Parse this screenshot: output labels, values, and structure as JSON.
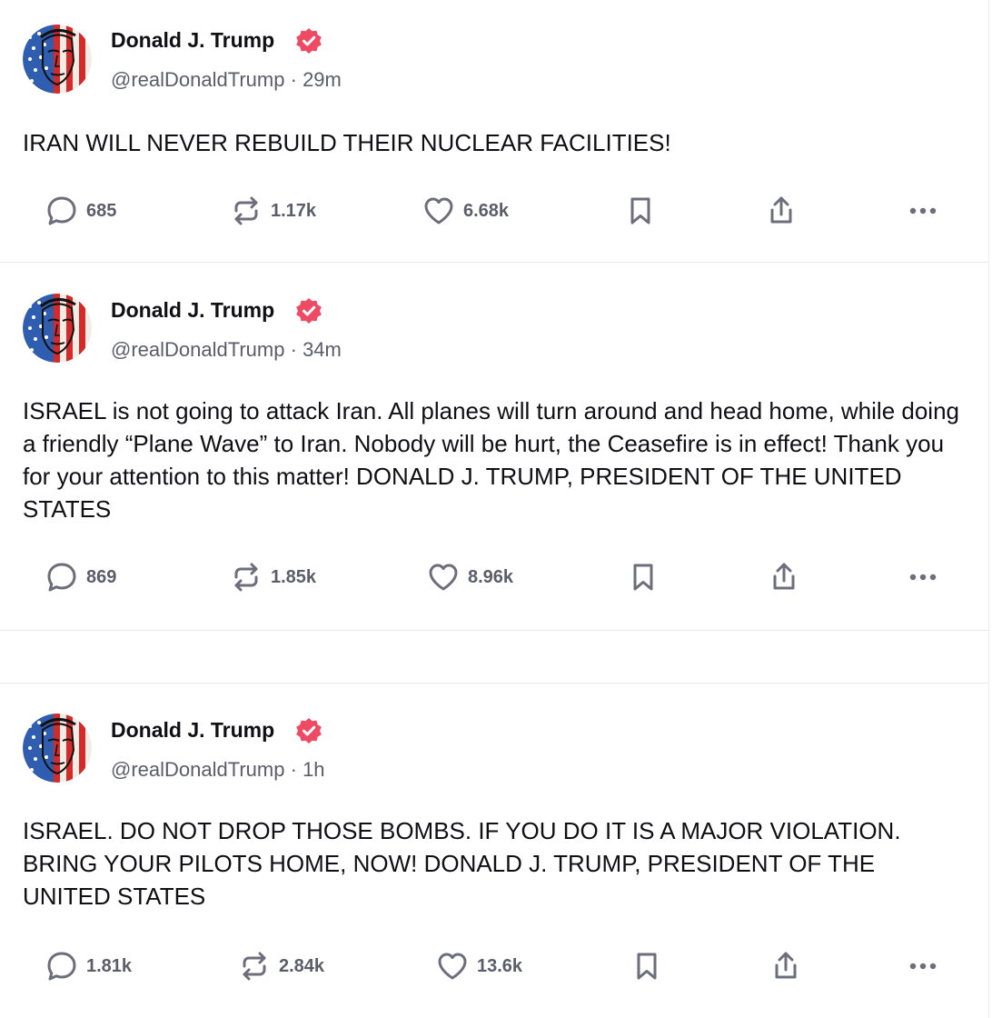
{
  "colors": {
    "badge": "#ee4a64",
    "text": "#0f0f14",
    "muted": "#5c5c6a",
    "icon": "#6d6d7b",
    "divider": "#e8e8ec"
  },
  "posts": [
    {
      "author": "Donald J. Trump",
      "handle": "@realDonaldTrump",
      "separator": "·",
      "time": "29m",
      "text": "IRAN WILL NEVER REBUILD THEIR NUCLEAR FACILITIES!",
      "replies": "685",
      "reposts": "1.17k",
      "likes": "6.68k"
    },
    {
      "author": "Donald J. Trump",
      "handle": "@realDonaldTrump",
      "separator": "·",
      "time": "34m",
      "text": "ISRAEL is not going to attack Iran. All planes will turn around and head home, while doing a friendly “Plane Wave” to Iran. Nobody will be hurt, the Ceasefire is in effect! Thank you for your attention to this matter! DONALD J. TRUMP, PRESIDENT OF THE UNITED STATES",
      "replies": "869",
      "reposts": "1.85k",
      "likes": "8.96k"
    },
    {
      "author": "Donald J. Trump",
      "handle": "@realDonaldTrump",
      "separator": "·",
      "time": "1h",
      "text": "ISRAEL. DO NOT DROP THOSE BOMBS. IF YOU DO IT IS A MAJOR VIOLATION. BRING YOUR PILOTS HOME, NOW!  DONALD J. TRUMP, PRESIDENT OF THE UNITED STATES",
      "replies": "1.81k",
      "reposts": "2.84k",
      "likes": "13.6k"
    }
  ]
}
